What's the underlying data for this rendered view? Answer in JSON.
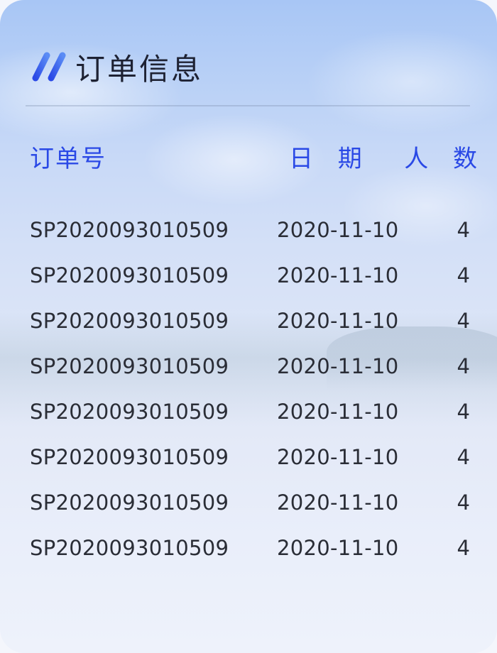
{
  "panel": {
    "title": "订单信息",
    "accent_color": "#2a49e6",
    "icon": "double-slash-icon"
  },
  "table": {
    "columns": {
      "order_no": "订单号",
      "date": "日 期",
      "count": "人 数"
    },
    "rows": [
      {
        "order_no": "SP2020093010509",
        "date": "2020-11-10",
        "count": "4"
      },
      {
        "order_no": "SP2020093010509",
        "date": "2020-11-10",
        "count": "4"
      },
      {
        "order_no": "SP2020093010509",
        "date": "2020-11-10",
        "count": "4"
      },
      {
        "order_no": "SP2020093010509",
        "date": "2020-11-10",
        "count": "4"
      },
      {
        "order_no": "SP2020093010509",
        "date": "2020-11-10",
        "count": "4"
      },
      {
        "order_no": "SP2020093010509",
        "date": "2020-11-10",
        "count": "4"
      },
      {
        "order_no": "SP2020093010509",
        "date": "2020-11-10",
        "count": "4"
      },
      {
        "order_no": "SP2020093010509",
        "date": "2020-11-10",
        "count": "4"
      }
    ]
  }
}
